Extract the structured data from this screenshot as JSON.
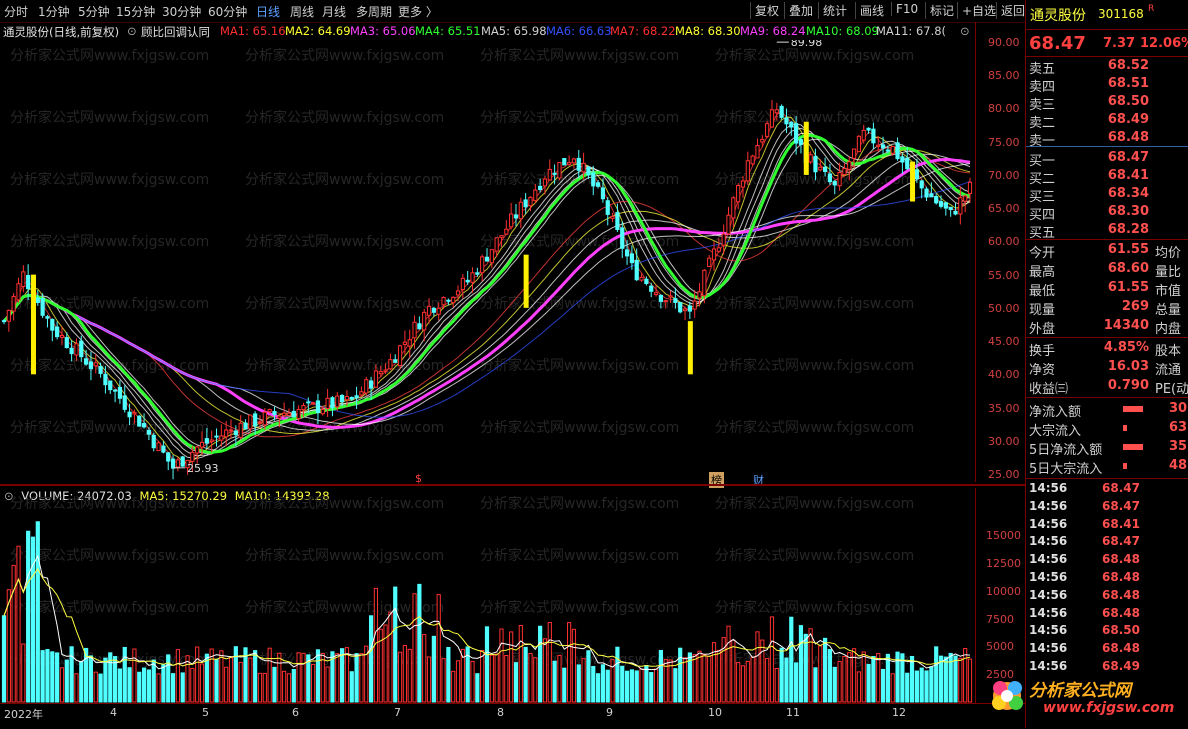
{
  "toolbar": {
    "periods": [
      "分时",
      "1分钟",
      "5分钟",
      "15分钟",
      "30分钟",
      "60分钟",
      "日线",
      "周线",
      "月线",
      "多周期",
      "更多 〉"
    ],
    "active_period": "日线",
    "right_buttons": [
      "复权",
      "叠加",
      "统计",
      "画线",
      "F10",
      "标记",
      "+自选",
      "返回"
    ]
  },
  "chart_header": {
    "stock_label": "通灵股份(日线,前复权)",
    "indicator": "顾比回调认同",
    "ma": [
      {
        "label": "MA1: 65.16",
        "color": "#ff3030"
      },
      {
        "label": "MA2: 64.69",
        "color": "#ffff30"
      },
      {
        "label": "MA3: 65.06",
        "color": "#ff40ff"
      },
      {
        "label": "MA4: 65.51",
        "color": "#30ff30"
      },
      {
        "label": "MA5: 65.98",
        "color": "#d0d0d0"
      },
      {
        "label": "MA6: 66.63",
        "color": "#3050ff"
      },
      {
        "label": "MA7: 68.22",
        "color": "#ff3030"
      },
      {
        "label": "MA8: 68.30",
        "color": "#ffff30"
      },
      {
        "label": "MA9: 68.24",
        "color": "#ff40ff"
      },
      {
        "label": "MA10: 68.09",
        "color": "#30ff30"
      },
      {
        "label": "MA11: 67.8(",
        "color": "#d0d0d0"
      }
    ]
  },
  "price_axis": [
    "90.00",
    "85.00",
    "80.00",
    "75.00",
    "70.00",
    "65.00",
    "60.00",
    "55.00",
    "50.00",
    "45.00",
    "40.00",
    "35.00",
    "30.00",
    "25.00"
  ],
  "annotations": {
    "high": "89.98",
    "low": "25.93",
    "tag_s": "$",
    "tag_bang": "榜",
    "tag_cai": "财"
  },
  "volume_header": {
    "vol": "VOLUME: 24072.03",
    "ma5": "MA5: 15270.29",
    "ma10": "MA10: 14393.28"
  },
  "volume_axis": [
    "15000",
    "12500",
    "10000",
    "7500",
    "5000",
    "2500"
  ],
  "x_axis": [
    "2022年",
    "4",
    "5",
    "6",
    "7",
    "8",
    "9",
    "10",
    "11",
    "12"
  ],
  "watermark": "分析家公式网www.fxjgsw.com",
  "quote": {
    "name": "通灵股份",
    "code": "301168",
    "r_mark": "R",
    "price": "68.47",
    "change": "7.37",
    "change_pct": "12.06%",
    "asks": [
      {
        "label": "卖五",
        "price": "68.52"
      },
      {
        "label": "卖四",
        "price": "68.51"
      },
      {
        "label": "卖三",
        "price": "68.50"
      },
      {
        "label": "卖二",
        "price": "68.49"
      },
      {
        "label": "卖一",
        "price": "68.48"
      }
    ],
    "bids": [
      {
        "label": "买一",
        "price": "68.47"
      },
      {
        "label": "买二",
        "price": "68.41"
      },
      {
        "label": "买三",
        "price": "68.34"
      },
      {
        "label": "买四",
        "price": "68.30"
      },
      {
        "label": "买五",
        "price": "68.28"
      }
    ],
    "stats1": [
      {
        "label": "今开",
        "value": "61.55",
        "label2": "均价"
      },
      {
        "label": "最高",
        "value": "68.60",
        "label2": "量比"
      },
      {
        "label": "最低",
        "value": "61.55",
        "label2": "市值"
      },
      {
        "label": "现量",
        "value": "269",
        "label2": "总量"
      },
      {
        "label": "外盘",
        "value": "14340",
        "label2": "内盘"
      }
    ],
    "stats2": [
      {
        "label": "换手",
        "value": "4.85%",
        "label2": "股本"
      },
      {
        "label": "净资",
        "value": "16.03",
        "label2": "流通"
      },
      {
        "label": "收益㈢",
        "value": "0.790",
        "label2": "PE(动"
      }
    ],
    "flows": [
      {
        "label": "净流入额",
        "value": "30"
      },
      {
        "label": "大宗流入",
        "value": "63!"
      },
      {
        "label": "5日净流入额",
        "value": "35"
      },
      {
        "label": "5日大宗流入",
        "value": "48:"
      }
    ],
    "ticks": [
      {
        "time": "14:56",
        "price": "68.47"
      },
      {
        "time": "14:56",
        "price": "68.47"
      },
      {
        "time": "14:56",
        "price": "68.41"
      },
      {
        "time": "14:56",
        "price": "68.47"
      },
      {
        "time": "14:56",
        "price": "68.48"
      },
      {
        "time": "14:56",
        "price": "68.48"
      },
      {
        "time": "14:56",
        "price": "68.48"
      },
      {
        "time": "14:56",
        "price": "68.48"
      },
      {
        "time": "14:56",
        "price": "68.50"
      },
      {
        "time": "14:56",
        "price": "68.48"
      },
      {
        "time": "14:56",
        "price": "68.49"
      }
    ]
  },
  "logo": {
    "text": "分析家公式网",
    "url": "www.fxjgsw.com"
  },
  "chart_data": {
    "type": "candlestick",
    "ylim": [
      24,
      92
    ],
    "key_points": [
      {
        "x": 0,
        "price": 48
      },
      {
        "x": 4,
        "price": 55
      },
      {
        "x": 10,
        "price": 47
      },
      {
        "x": 20,
        "price": 40
      },
      {
        "x": 28,
        "price": 33
      },
      {
        "x": 35,
        "price": 26
      },
      {
        "x": 40,
        "price": 29
      },
      {
        "x": 48,
        "price": 32
      },
      {
        "x": 56,
        "price": 34
      },
      {
        "x": 64,
        "price": 35
      },
      {
        "x": 72,
        "price": 36
      },
      {
        "x": 80,
        "price": 42
      },
      {
        "x": 88,
        "price": 50
      },
      {
        "x": 96,
        "price": 54
      },
      {
        "x": 104,
        "price": 62
      },
      {
        "x": 112,
        "price": 70
      },
      {
        "x": 118,
        "price": 73
      },
      {
        "x": 124,
        "price": 66
      },
      {
        "x": 130,
        "price": 56
      },
      {
        "x": 136,
        "price": 52
      },
      {
        "x": 142,
        "price": 49
      },
      {
        "x": 148,
        "price": 60
      },
      {
        "x": 154,
        "price": 72
      },
      {
        "x": 160,
        "price": 80
      },
      {
        "x": 166,
        "price": 73
      },
      {
        "x": 172,
        "price": 68
      },
      {
        "x": 178,
        "price": 76
      },
      {
        "x": 184,
        "price": 74
      },
      {
        "x": 190,
        "price": 68
      },
      {
        "x": 196,
        "price": 64
      },
      {
        "x": 200,
        "price": 68
      }
    ],
    "volume_ylim": [
      0,
      18000
    ],
    "volume_ma5_last": 15270.29,
    "volume_ma10_last": 14393.28
  }
}
